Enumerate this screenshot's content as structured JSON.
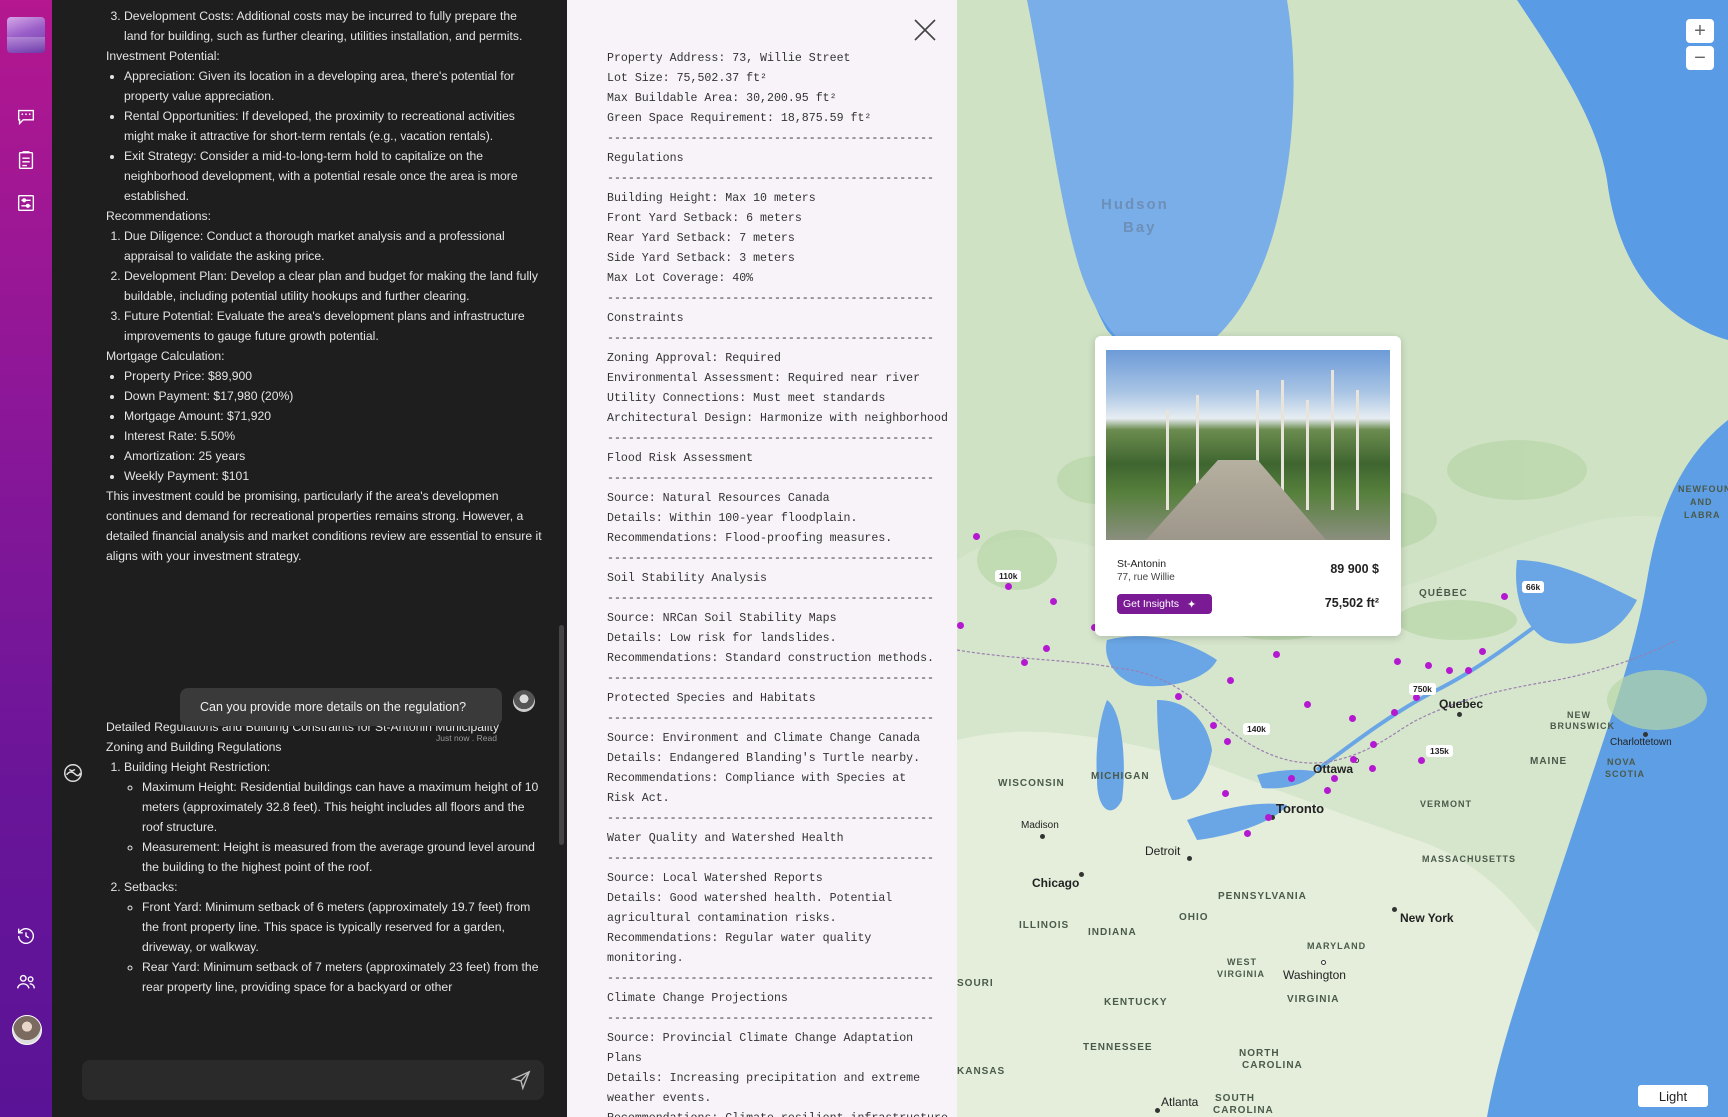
{
  "chat": {
    "top_items": [
      "Development Costs: Additional costs may be incurred to fully prepare the land for building, such as further clearing, utilities installation, and permits."
    ],
    "investment_heading": "Investment Potential:",
    "investment_items": [
      "Appreciation: Given its location in a developing area, there's potential for property value appreciation.",
      "Rental Opportunities: If developed, the proximity to recreational activities might make it attractive for short-term rentals (e.g., vacation rentals).",
      "Exit Strategy: Consider a mid-to-long-term hold to capitalize on the neighborhood development, with a potential resale once the area is more established."
    ],
    "recommendations_heading": "Recommendations:",
    "recommendations": [
      "Due Diligence: Conduct a thorough market analysis and a professional appraisal to validate the asking price.",
      "Development Plan: Develop a clear plan and budget for making the land fully buildable, including potential utility hookups and further clearing.",
      "Future Potential: Evaluate the area's development plans and infrastructure improvements to gauge future growth potential."
    ],
    "mortgage_heading": "Mortgage Calculation:",
    "mortgage_items": [
      "Property Price: $89,900",
      "Down Payment: $17,980 (20%)",
      "Mortgage Amount: $71,920",
      "Interest Rate: 5.50%",
      "Amortization: 25 years",
      "Weekly Payment: $101"
    ],
    "closing_text": "This investment could be promising, particularly if the area's developmen continues and demand for recreational properties remains strong. However, a detailed financial analysis and market conditions review are essential to ensure it aligns with your investment strategy.",
    "user_message": "Can you provide more details on the regulation?",
    "user_message_meta": "Just now . Read",
    "reply_title": "Detailed Regulations and Building Constraints for St-Antonin Municipality",
    "reply_subtitle": "Zoning and Building Regulations",
    "reply_sections": [
      {
        "title": "Building Height Restriction:",
        "items": [
          "Maximum Height: Residential buildings can have a maximum height of 10 meters (approximately 32.8 feet). This height includes all floors and the roof structure.",
          "Measurement: Height is measured from the average ground level around the building to the highest point of the roof."
        ]
      },
      {
        "title": "Setbacks:",
        "items": [
          "Front Yard: Minimum setback of 6 meters (approximately 19.7 feet) from the front property line. This space is typically reserved for a garden, driveway, or walkway.",
          "Rear Yard: Minimum setback of 7 meters (approximately 23 feet) from the rear property line, providing space for a backyard or other"
        ]
      }
    ],
    "composer_placeholder": ""
  },
  "detail": {
    "lines": [
      "Property Address: 73, Willie Street",
      "Lot Size: 75,502.37 ft²",
      "Max Buildable Area: 30,200.95 ft²",
      "Green Space Requirement: 18,875.59 ft²",
      "-----------------------------------------------",
      "Regulations",
      "-----------------------------------------------",
      "Building Height: Max 10 meters",
      "Front Yard Setback: 6 meters",
      "Rear Yard Setback: 7 meters",
      "Side Yard Setback: 3 meters",
      "Max Lot Coverage: 40%",
      "-----------------------------------------------",
      "Constraints",
      "-----------------------------------------------",
      "Zoning Approval: Required",
      "Environmental Assessment: Required near river",
      "Utility Connections: Must meet standards",
      "Architectural Design: Harmonize with neighborhood",
      "-----------------------------------------------",
      "Flood Risk Assessment",
      "-----------------------------------------------",
      "Source: Natural Resources Canada",
      "Details: Within 100-year floodplain.",
      "Recommendations: Flood-proofing measures.",
      "-----------------------------------------------",
      "Soil Stability Analysis",
      "-----------------------------------------------",
      "Source: NRCan Soil Stability Maps",
      "Details: Low risk for landslides.",
      "Recommendations: Standard construction methods.",
      "-----------------------------------------------",
      "Protected Species and Habitats",
      "-----------------------------------------------",
      "Source: Environment and Climate Change Canada",
      "Details: Endangered Blanding's Turtle nearby.",
      "Recommendations: Compliance with Species at",
      "Risk Act.",
      "-----------------------------------------------",
      "Water Quality and Watershed Health",
      "-----------------------------------------------",
      "Source: Local Watershed Reports",
      "Details: Good watershed health. Potential",
      "agricultural contamination risks.",
      "Recommendations: Regular water quality",
      "monitoring.",
      "-----------------------------------------------",
      "Climate Change Projections",
      "-----------------------------------------------",
      "Source: Provincial Climate Change Adaptation",
      "Plans",
      "Details: Increasing precipitation and extreme",
      "weather events.",
      "Recommendations: Climate-resilient infrastructure."
    ]
  },
  "card": {
    "town": "St-Antonin",
    "street": "77, rue Willie",
    "price": "89 900 $",
    "area": "75,502 ft²",
    "insights_label": "Get Insights",
    "accent": "#7a1a95"
  },
  "map": {
    "labels": {
      "hudson1": "Hudson",
      "hudson2": "Bay",
      "quebec_prov": "QUÉBEC",
      "newfoundland1": "NEWFOUN",
      "newfoundland2": "AND",
      "newfoundland3": "LABRA",
      "new_brunswick1": "NEW",
      "new_brunswick2": "BRUNSWICK",
      "nova_scotia1": "NOVA",
      "nova_scotia2": "SCOTIA",
      "maine": "MAINE",
      "vermont": "VERMONT",
      "massachusetts": "MASSACHUSETTS",
      "pennsylvania": "PENNSYLVANIA",
      "ohio": "OHIO",
      "indiana": "INDIANA",
      "illinois": "ILLINOIS",
      "michigan": "MICHIGAN",
      "wisconsin": "WISCONSIN",
      "west_virginia1": "WEST",
      "west_virginia2": "VIRGINIA",
      "virginia": "VIRGINIA",
      "maryland": "MARYLAND",
      "kentucky": "KENTUCKY",
      "tennessee": "TENNESSEE",
      "north_carolina1": "NORTH",
      "north_carolina2": "CAROLINA",
      "south_carolina1": "SOUTH",
      "south_carolina2": "CAROLINA",
      "kansas": "KANSAS",
      "missouri": "SOURI"
    },
    "cities": {
      "quebec": "Quebec",
      "ottawa": "Ottawa",
      "toronto": "Toronto",
      "detroit": "Detroit",
      "chicago": "Chicago",
      "madison": "Madison",
      "new_york": "New York",
      "washington": "Washington",
      "atlanta": "Atlanta",
      "charlottetown": "Charlottetown"
    },
    "price_tags": [
      "110k",
      "66k",
      "750k",
      "140k",
      "135k"
    ],
    "pin_color": "#b418d0",
    "zoom_in": "+",
    "zoom_out": "−",
    "theme_label": "Light"
  }
}
